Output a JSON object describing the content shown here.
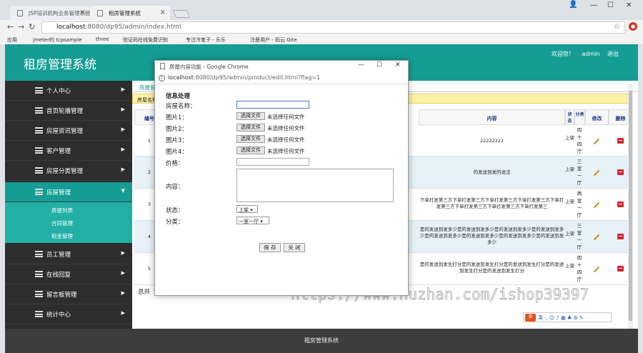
{
  "browser": {
    "tabs": [
      {
        "label": "JSP培训机构业务管理系统"
      },
      {
        "label": "租房管理系统"
      }
    ],
    "url_host": "localhost",
    "url_path": ":8080/dp95/admin/index.html",
    "bookmarks": [
      "应用",
      "jmeter的 tcpsample",
      "three",
      "验证码在线免费识别",
      "专注冷笔子 - 乐乐",
      "注册用户 - 码云 Gite"
    ]
  },
  "header": {
    "title": "租房管理系统",
    "welcome": "欢迎您！",
    "user": "admin",
    "logout": "退出"
  },
  "sidebar": {
    "items": [
      {
        "label": "个人中心"
      },
      {
        "label": "首页轮播管理"
      },
      {
        "label": "房屋资讯管理"
      },
      {
        "label": "客户管理"
      },
      {
        "label": "房屋分类管理"
      },
      {
        "label": "房屋管理"
      },
      {
        "label": "员工管理"
      },
      {
        "label": "在线回复"
      },
      {
        "label": "留言板管理"
      },
      {
        "label": "统计中心"
      }
    ],
    "subitems": [
      {
        "label": "房屋列表"
      },
      {
        "label": "合同管理"
      },
      {
        "label": "租金管理"
      }
    ]
  },
  "content": {
    "breadcrumb": "房屋管",
    "warning": "房屋名称",
    "table": {
      "headers": [
        "编号",
        "内容",
        "状态",
        "分类",
        "修改",
        "删除"
      ],
      "rows": [
        {
          "id": "1",
          "content": "22222222",
          "status": "上架",
          "category": "四十四厅"
        },
        {
          "id": "2",
          "content": "的发送到发的说法",
          "status": "上架",
          "category": "三室一厅"
        },
        {
          "id": "3",
          "content": "下单打发第三方下单打发第三方下单打发第三方下单打发第三方下单打发第三方下单打发第三方下单打发第三方下单打发第三",
          "status": "上架",
          "category": "两室一厅"
        },
        {
          "id": "4",
          "content": "是的发送到发多少是的发送到发多少是的发送到发多少是的发送到发多少是的发送到发多少是的发送到发多少是的发送到发多少是的发送到发多少",
          "status": "上架",
          "category": "三室一厅"
        },
        {
          "id": "5",
          "content": "是的发送到发生打分是的发送到发生打分是的发送到发生打分是的发送到发生打分是的发送到发生打分",
          "status": "上架",
          "category": "四十四厅"
        }
      ]
    },
    "total": "总共"
  },
  "popup": {
    "title": "房屋内容功能 - Google Chrome",
    "url_host": "localhost",
    "url_path": ":8080/dp95/admin/product/edit.html?flag=1",
    "form_title": "信息处理",
    "labels": {
      "name": "房屋名称：",
      "img1": "图片1：",
      "img2": "图片2：",
      "img3": "图片3：",
      "img4": "图片4：",
      "price": "价格：",
      "content": "内容：",
      "status": "状态：",
      "category": "分类："
    },
    "file_button": "选择文件",
    "no_file": "未选择任何文件",
    "status_value": "上架",
    "category_value": "一室一厅",
    "save": "保 存",
    "close": "关 闭"
  },
  "footer": {
    "text": "租房管理系统"
  },
  "ime": {
    "label": "英"
  },
  "watermark": "https://www.huzhan.com/ishop39397"
}
